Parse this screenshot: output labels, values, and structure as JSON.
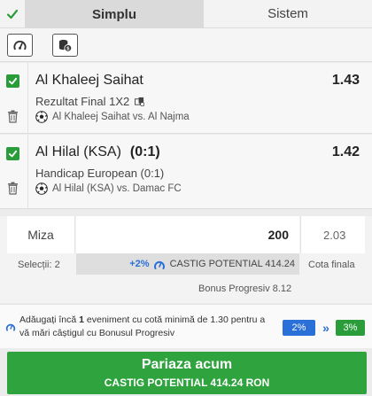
{
  "tabs": {
    "simplu": "Simplu",
    "sistem": "Sistem"
  },
  "toolbar": {
    "icons": [
      "speedometer-icon",
      "coins-icon"
    ]
  },
  "bets": [
    {
      "team": "Al Khaleej Saihat",
      "handicap": "",
      "odd": "1.43",
      "market": "Rezultat Final 1X2",
      "event": "Al Khaleej Saihat vs. Al Najma"
    },
    {
      "team": "Al Hilal (KSA)",
      "handicap": "(0:1)",
      "odd": "1.42",
      "market": "Handicap European (0:1)",
      "event": "Al Hilal (KSA) vs. Damac FC"
    }
  ],
  "stake": {
    "label": "Miza",
    "value": "200",
    "total_odds": "2.03",
    "selections": "Selecții: 2",
    "bonus_pct": "+2%",
    "potential": "CASTIG POTENTIAL 414.24",
    "final_odds_label": "Cota finala",
    "bonus_progressive": "Bonus Progresiv 8.12"
  },
  "banner": {
    "text_before": "Adăugați încă ",
    "count": "1",
    "text_after": " eveniment cu cotă minimă de 1.30 pentru a vă mări câștigul cu Bonusul Progresiv",
    "current_pct": "2%",
    "arrow": "»",
    "next_pct": "3%"
  },
  "place_bet": {
    "title": "Pariaza acum",
    "subtitle": "CASTIG POTENTIAL  414.24 RON"
  },
  "colors": {
    "green": "#2fa33e",
    "blue": "#2b6fd8"
  }
}
